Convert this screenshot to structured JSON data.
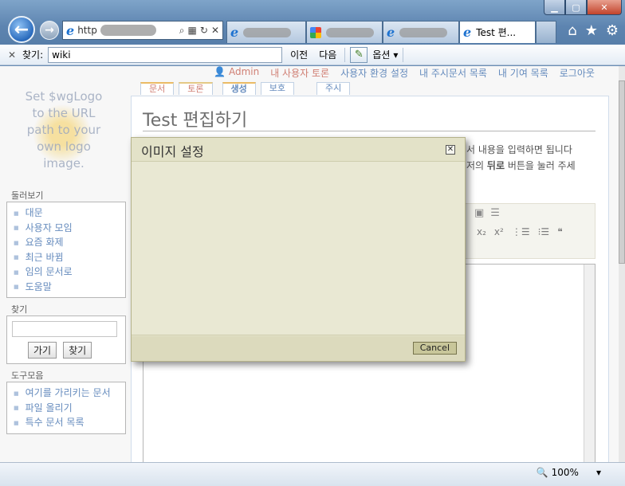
{
  "browser": {
    "window_controls": {
      "min": "▁",
      "max": "▢",
      "close": "✕"
    },
    "back_icon": "←",
    "forward_icon": "→",
    "address": {
      "value": "http"
    },
    "tabs": [
      {
        "title": ""
      },
      {
        "title": ""
      },
      {
        "title": ""
      },
      {
        "title": "Test 편..."
      }
    ],
    "find": {
      "label": "찾기:",
      "value": "wiki",
      "prev": "이전",
      "next": "다음",
      "options": "옵션"
    },
    "zoom": "100%"
  },
  "wiki": {
    "logo_text": [
      "Set $wgLogo",
      "to the URL",
      "path to your",
      "own logo",
      "image."
    ],
    "usermenu": {
      "user": "Admin",
      "talk": "내 사용자 토론",
      "prefs": "사용자 환경 설정",
      "watchlist": "내 주시문서 목록",
      "contribs": "내 기여 목록",
      "logout": "로그아웃"
    },
    "page_tabs": {
      "article": "문서",
      "discussion": "토론",
      "create": "생성",
      "protect": "보호",
      "watch": "주시"
    },
    "page_title": "Test 편집하기",
    "intro_line1": "서 내용을 입력하면 됩니다",
    "intro_line2_a": "저의 ",
    "intro_line2_b": "뒤로",
    "intro_line2_c": " 버튼을 눌러 주세",
    "navigation": {
      "heading": "둘러보기",
      "items": [
        "대문",
        "사용자 모임",
        "요즘 화제",
        "최근 바뀜",
        "임의 문서로",
        "도움말"
      ]
    },
    "search": {
      "heading": "찾기",
      "go": "가기",
      "search": "찾기"
    },
    "toolbox": {
      "heading": "도구모음",
      "items": [
        "여기를 가리키는 문서",
        "파일 올리기",
        "특수 문서 목록"
      ]
    }
  },
  "dialog": {
    "title": "이미지 설정",
    "cancel": "Cancel"
  }
}
